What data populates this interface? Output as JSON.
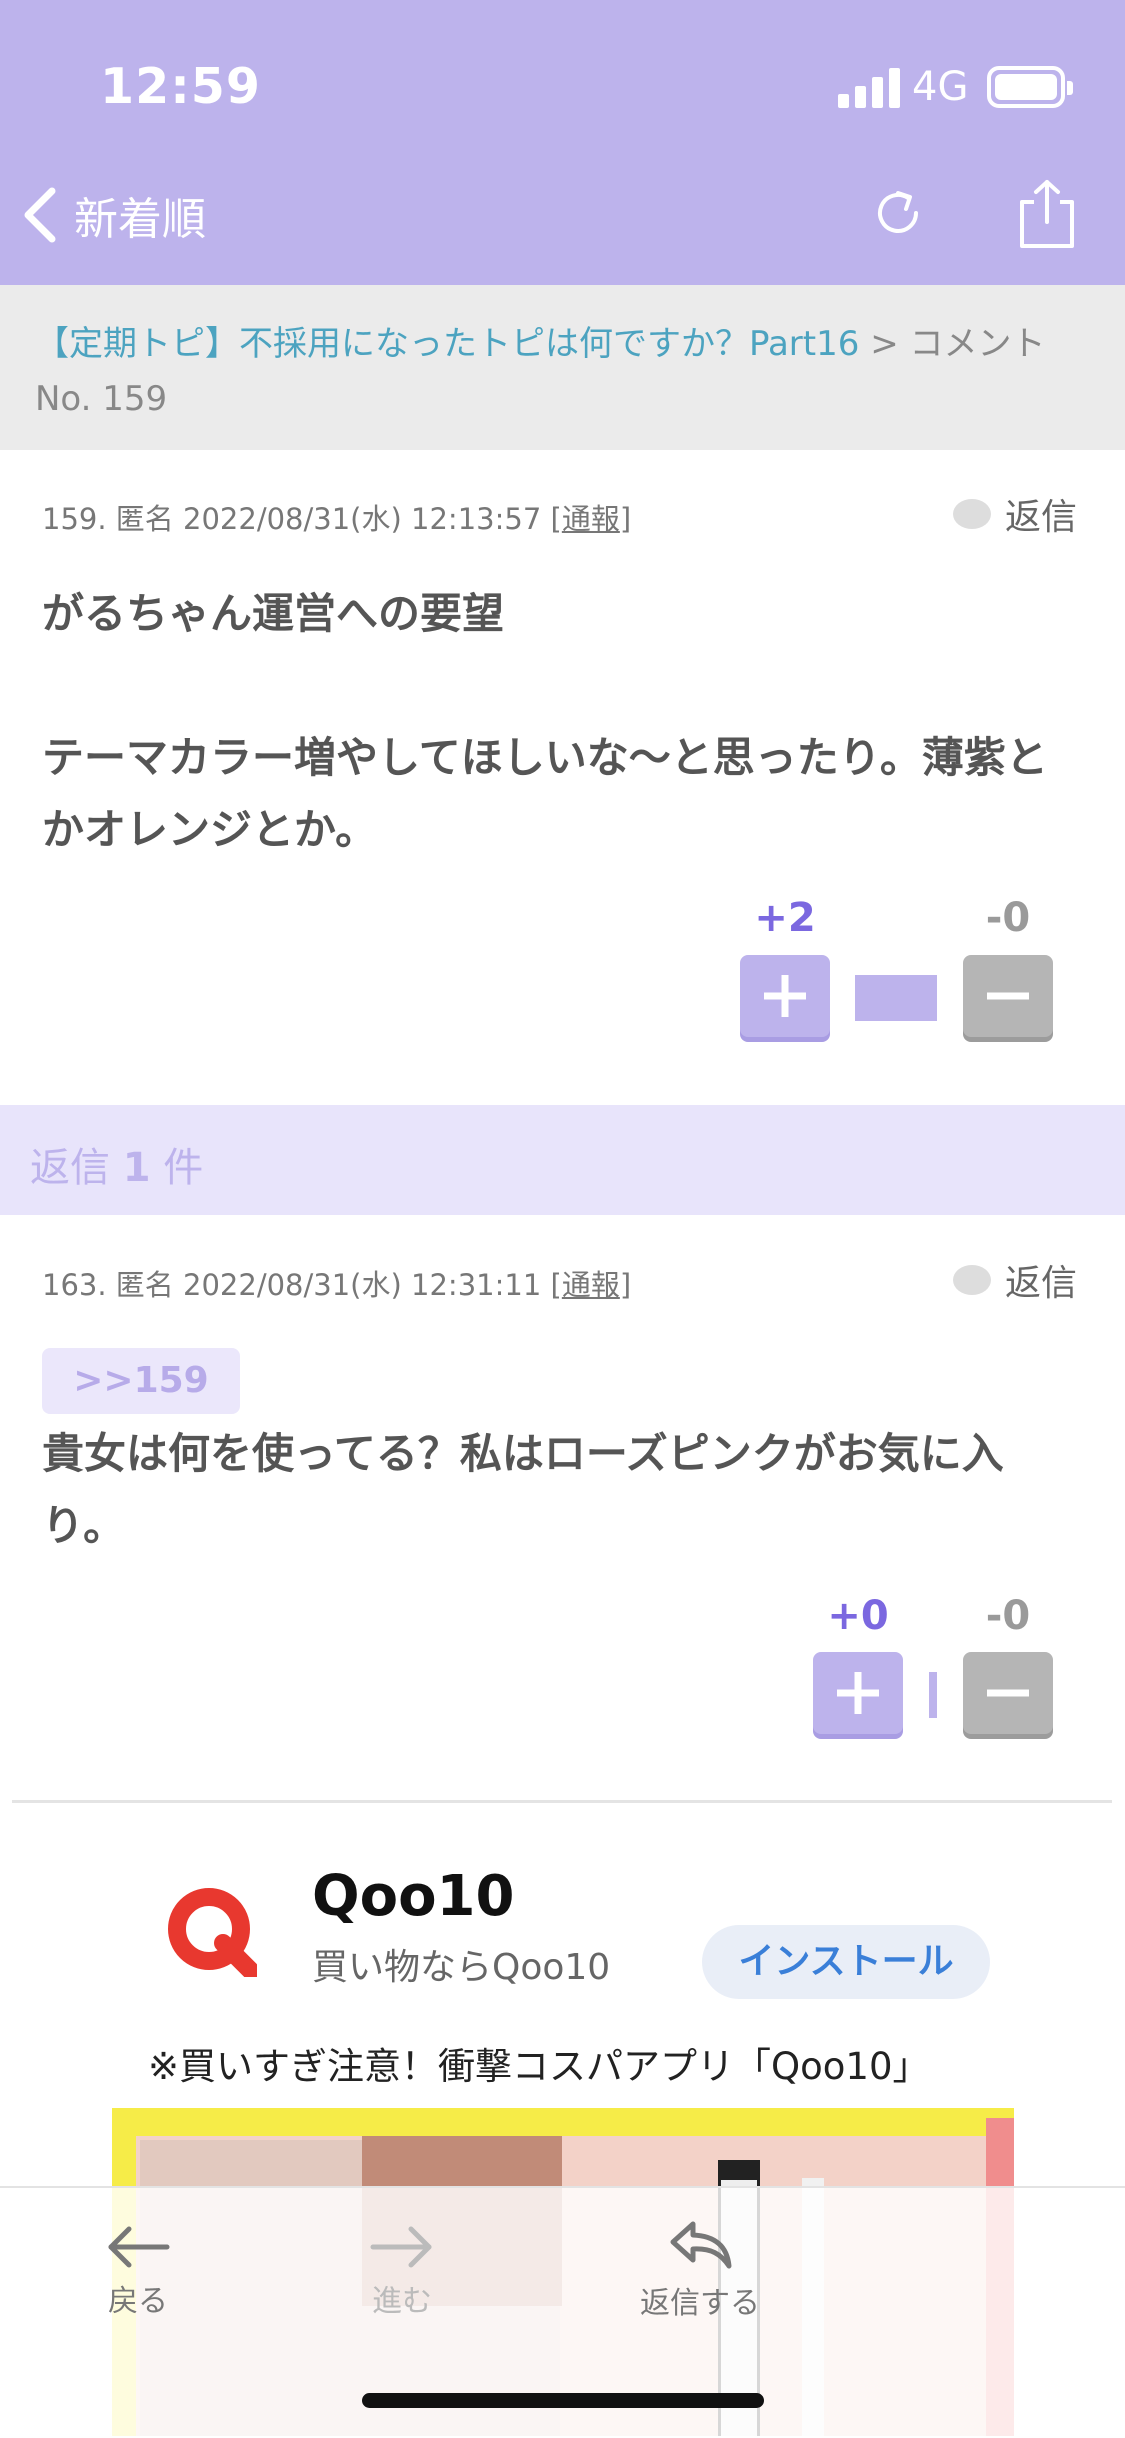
{
  "status_bar": {
    "time": "12:59",
    "network": "4G"
  },
  "nav": {
    "back_label": "新着順"
  },
  "breadcrumb": {
    "topic": "【定期トピ】不採用になったトピは何ですか？Part16",
    "separator": ">",
    "current": "コメント No. 159"
  },
  "comments": [
    {
      "number": "159.",
      "author": "匿名",
      "datetime": "2022/08/31(水) 12:13:57",
      "report_label": "通報",
      "reply_label": "返信",
      "line1": "がるちゃん運営への要望",
      "line2": "テーマカラー増やしてほしいな〜と思ったり。薄紫とかオレンジとか。",
      "plus_count": "+2",
      "minus_count": "-0"
    },
    {
      "number": "163.",
      "author": "匿名",
      "datetime": "2022/08/31(水) 12:31:11",
      "report_label": "通報",
      "reply_label": "返信",
      "anchor": ">>159",
      "text": "貴女は何を使ってる？私はローズピンクがお気に入り。",
      "plus_count": "+0",
      "minus_count": "-0"
    }
  ],
  "replies_bar": {
    "prefix": "返信",
    "count": "1",
    "suffix": "件"
  },
  "ad": {
    "title": "Qoo10",
    "subtitle": "買い物ならQoo10",
    "install_label": "インストール",
    "description": "※買いすぎ注意！衝撃コスパアプリ「Qoo10」",
    "logo_color": "#e8382f"
  },
  "toolbar": {
    "back_label": "戻る",
    "forward_label": "進む",
    "reply_label": "返信する"
  },
  "colors": {
    "accent": "#bdb3ec",
    "accent_text": "#7b68e0",
    "link": "#4ca3c0",
    "install_text": "#3a7fd8"
  }
}
